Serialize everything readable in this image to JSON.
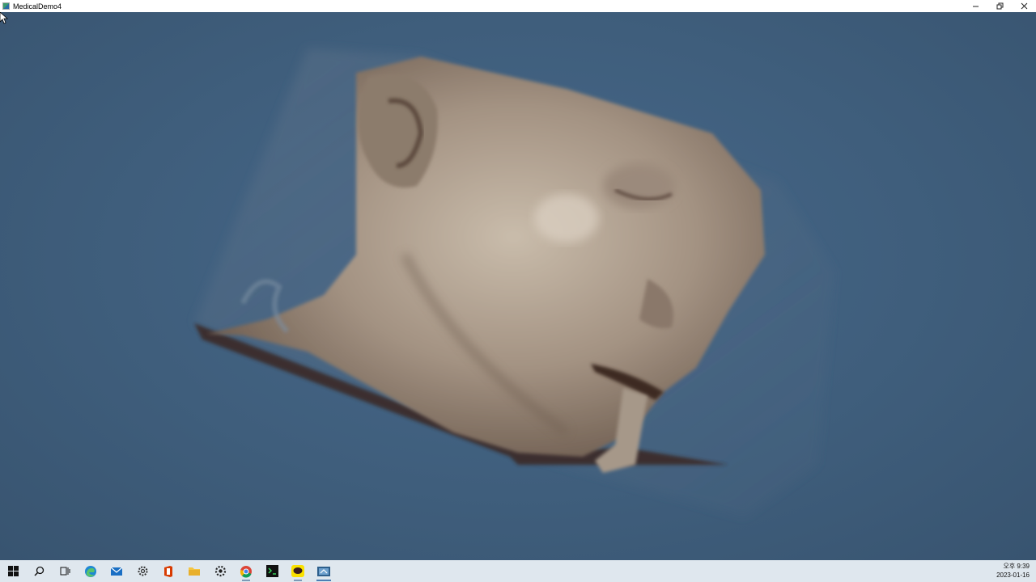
{
  "window": {
    "title": "MedicalDemo4",
    "minimize_icon": "minimize-icon",
    "restore_icon": "restore-icon",
    "close_icon": "close-icon"
  },
  "viewport": {
    "content": "3D volume rendering of head CT scan",
    "background_color": "#3e5b78"
  },
  "taskbar": {
    "items": [
      {
        "name": "start-icon"
      },
      {
        "name": "search-icon"
      },
      {
        "name": "task-view-icon"
      },
      {
        "name": "edge-icon"
      },
      {
        "name": "mail-icon"
      },
      {
        "name": "settings-cog-icon"
      },
      {
        "name": "office-icon"
      },
      {
        "name": "file-explorer-icon"
      },
      {
        "name": "settings-gear-icon"
      },
      {
        "name": "chrome-icon"
      },
      {
        "name": "terminal-app-icon"
      },
      {
        "name": "kakaotalk-icon"
      },
      {
        "name": "medicaldemo-app-icon"
      }
    ],
    "clock": {
      "time": "오후 9:39",
      "date": "2023-01-16"
    }
  }
}
